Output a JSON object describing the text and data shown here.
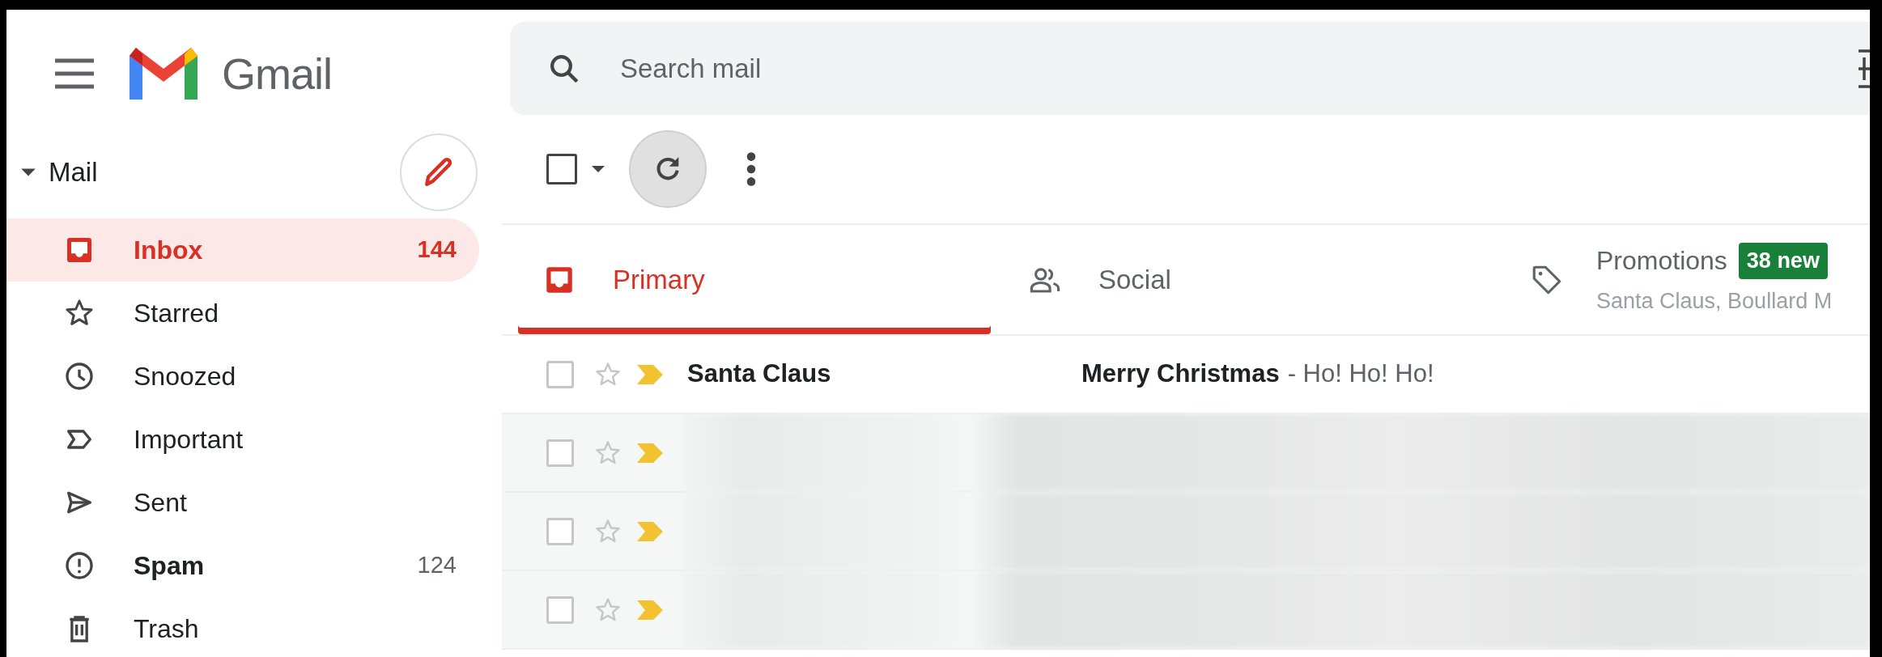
{
  "app": {
    "name": "Gmail"
  },
  "search": {
    "placeholder": "Search mail"
  },
  "sidebar": {
    "section": {
      "label": "Mail",
      "expanded": true
    },
    "items": [
      {
        "kind": "inbox",
        "label": "Inbox",
        "count": "144",
        "selected": true,
        "unread": true
      },
      {
        "kind": "starred",
        "label": "Starred",
        "selected": false,
        "unread": false
      },
      {
        "kind": "snoozed",
        "label": "Snoozed",
        "selected": false,
        "unread": false
      },
      {
        "kind": "important",
        "label": "Important",
        "selected": false,
        "unread": false
      },
      {
        "kind": "sent",
        "label": "Sent",
        "selected": false,
        "unread": false
      },
      {
        "kind": "spam",
        "label": "Spam",
        "count": "124",
        "selected": false,
        "unread": true
      },
      {
        "kind": "trash",
        "label": "Trash",
        "selected": false,
        "unread": false
      }
    ]
  },
  "toolbar": {
    "select_all": {
      "checked": false
    }
  },
  "tabs": [
    {
      "kind": "primary",
      "label": "Primary",
      "selected": true
    },
    {
      "kind": "social",
      "label": "Social",
      "selected": false
    },
    {
      "kind": "promotions",
      "label": "Promotions",
      "badge": "38 new",
      "senders": "Santa Claus, Boullard M",
      "selected": false
    }
  ],
  "emails": [
    {
      "kind": "message",
      "sender": "Santa Claus",
      "subject": "Merry Christmas",
      "snippet": "- Ho! Ho! Ho!",
      "checked": false,
      "starred": false,
      "important": true,
      "unread": true
    },
    {
      "kind": "blurred",
      "checked": false,
      "starred": false,
      "important": true
    },
    {
      "kind": "blurred",
      "checked": false,
      "starred": false,
      "important": true
    },
    {
      "kind": "blurred",
      "checked": false,
      "starred": false,
      "important": true
    }
  ]
}
